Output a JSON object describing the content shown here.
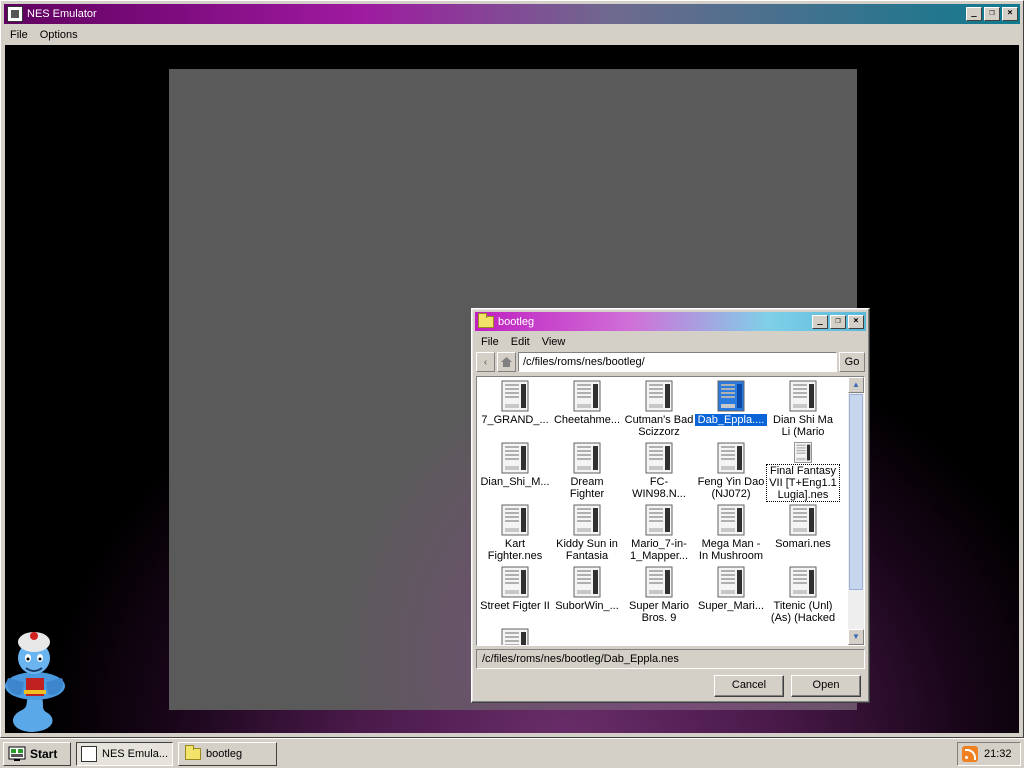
{
  "main_window": {
    "title": "NES Emulator",
    "menu": [
      "File",
      "Options"
    ],
    "controls": [
      "_",
      "❐",
      "×"
    ]
  },
  "dialog": {
    "title": "bootleg",
    "menu": [
      "File",
      "Edit",
      "View"
    ],
    "back_label": "‹",
    "path": "/c/files/roms/nes/bootleg/",
    "go_label": "Go",
    "selected_path": "/c/files/roms/nes/bootleg/Dab_Eppla.nes",
    "cancel_label": "Cancel",
    "open_label": "Open",
    "files": [
      {
        "label": "7_GRAND_..."
      },
      {
        "label": "Cheetahme..."
      },
      {
        "label": "Cutman's Bad Scizzorz"
      },
      {
        "label": "Dab_Eppla....",
        "selected": true
      },
      {
        "label": "Dian Shi Ma Li (Mario"
      },
      {
        "label": "Dian_Shi_M..."
      },
      {
        "label": "Dream Fighter"
      },
      {
        "label": "FC-WIN98.N..."
      },
      {
        "label": "Feng Yin Dao (NJ072)"
      },
      {
        "label": "Final Fantasy VII [T+Eng1.1 Lugia].nes",
        "focused": true
      },
      {
        "label": "Kart Fighter.nes"
      },
      {
        "label": "Kiddy Sun in Fantasia"
      },
      {
        "label": "Mario_7-in-1_Mapper..."
      },
      {
        "label": "Mega Man - In Mushroom"
      },
      {
        "label": "Somari.nes"
      },
      {
        "label": "Street Figter II"
      },
      {
        "label": "SuborWin_..."
      },
      {
        "label": "Super Mario Bros. 9"
      },
      {
        "label": "Super_Mari..."
      },
      {
        "label": "Titenic (Unl) (As) (Hacked"
      },
      {
        "label": ""
      }
    ]
  },
  "taskbar": {
    "start_label": "Start",
    "tasks": [
      {
        "label": "NES Emula...",
        "icon": "app-window-icon",
        "active": true
      },
      {
        "label": "bootleg",
        "icon": "folder-icon",
        "active": false
      }
    ],
    "clock": "21:32",
    "tray_icon": "rss-icon"
  },
  "colors": {
    "selection": "#0a64d8",
    "desktop_glow": "#6a2e6a"
  }
}
